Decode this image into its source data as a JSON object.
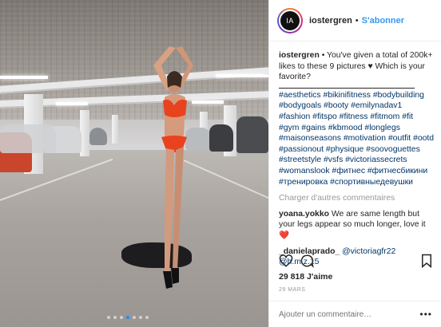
{
  "post": {
    "username": "iostergren",
    "separator": "•",
    "follow_label": "S'abonner",
    "avatar_text": "IA",
    "caption_user": "iostergren",
    "caption_text": "• You've given a total of 200k+ likes to these 9 pictures ♥ Which is your favorite?",
    "hashtags": "#aesthetics #bikinifitness #bodybuilding #bodygoals #booty #emilynadav1 #fashion #fitspo #fitness #fitmom #fit #gym #gains #kbmood #longlegs #maisonseasons #motivation #outfit #ootd #passionout #physique #soovoguettes #streetstyle #vsfs #victoriassecrets #womanslook #фитнес #фитнесбикини #тренировка #спортивныедевушки",
    "load_more": "Charger d'autres commentaires",
    "comments": [
      {
        "user": "yoana.yokko",
        "text": "We are same length but your legs appear so much longer, love it",
        "emoji": "❤️"
      },
      {
        "user": "_danielaprado_",
        "mentions": "@victoriagfr22 @h.m.z.15"
      }
    ],
    "likes": "29 818 J'aime",
    "date": "29 MARS",
    "add_comment_placeholder": "Ajouter un commentaire…",
    "more_glyph": "•••",
    "carousel": {
      "count": 7,
      "active_index": 3
    }
  },
  "icons": [
    "heart-icon",
    "comment-icon",
    "bookmark-icon",
    "more-options-icon"
  ],
  "colors": {
    "accent": "#3897f0",
    "hashtag": "#003569",
    "muted": "#999999",
    "bikini": "#e8421e"
  }
}
